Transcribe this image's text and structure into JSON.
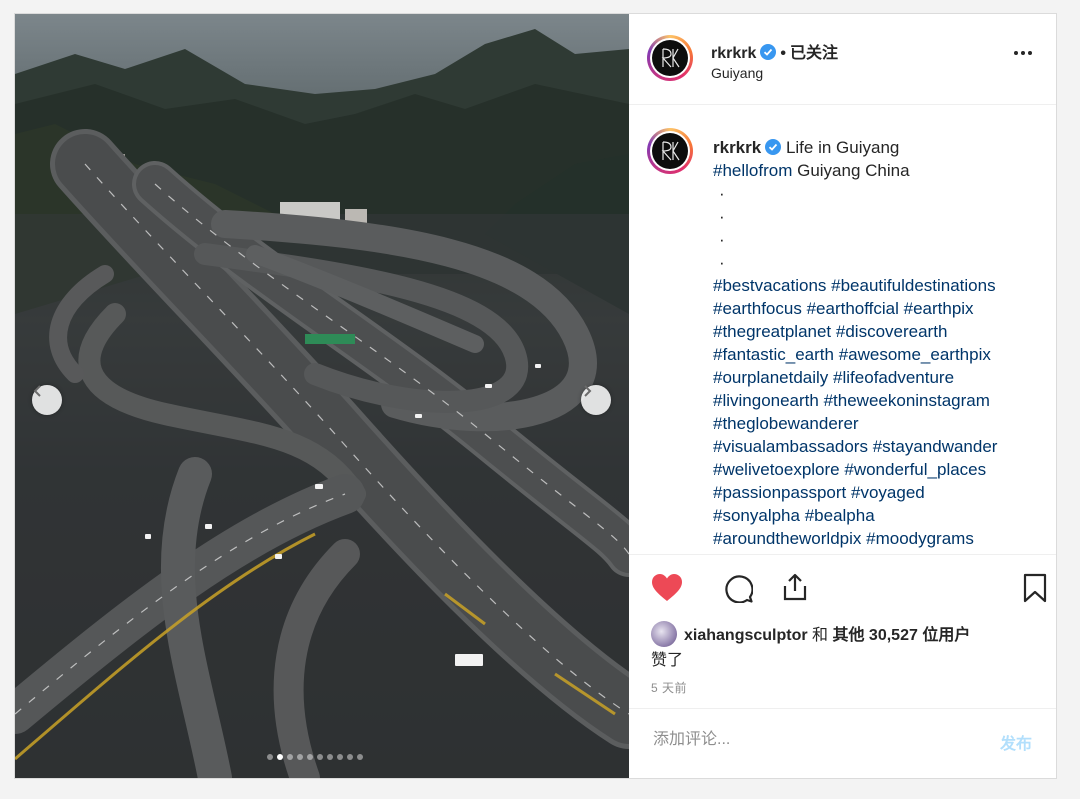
{
  "header": {
    "username": "rkrkrk",
    "separator": "•",
    "follow_status": "已关注",
    "location": "Guiyang",
    "more_icon": "more-horizontal-icon",
    "avatar_monogram": "RK"
  },
  "media": {
    "prev_icon": "chevron-left-icon",
    "next_icon": "chevron-right-icon",
    "carousel": {
      "count": 10,
      "active_index": 1
    }
  },
  "caption": {
    "username": "rkrkrk",
    "first_line_text": "Life in Guiyang",
    "second_line": {
      "hashtag": "#hellofrom",
      "text": " Guiyang China"
    },
    "dots": [
      "·",
      "·",
      "·",
      "·"
    ],
    "hashtag_lines": [
      [
        "#bestvacations",
        "#beautifuldestinations"
      ],
      [
        "#earthfocus",
        "#earthoffcial",
        "#earthpix"
      ],
      [
        "#thegreatplanet",
        "#discoverearth"
      ],
      [
        "#fantastic_earth",
        "#awesome_earthpix"
      ],
      [
        "#ourplanetdaily",
        "#lifeofadventure"
      ],
      [
        "#livingonearth",
        "#theweekoninstagram"
      ],
      [
        "#theglobewanderer"
      ],
      [
        "#visualambassadors",
        "#stayandwander"
      ],
      [
        "#welivetoexplore",
        "#wonderful_places"
      ],
      [
        "#passionpassport",
        "#voyaged"
      ],
      [
        "#sonyalpha",
        "#bealpha"
      ],
      [
        "#aroundtheworldpix",
        "#moodygrams"
      ]
    ]
  },
  "actions": {
    "like_icon": "heart-filled-icon",
    "comment_icon": "comment-bubble-icon",
    "share_icon": "share-upload-icon",
    "save_icon": "bookmark-icon",
    "liked_by": "xiahangsculptor",
    "and_text": " 和 ",
    "others_text": "其他 30,527 位用户",
    "liked_suffix": "赞了",
    "timestamp": "5 天前"
  },
  "comment": {
    "placeholder": "添加评论...",
    "post_label": "发布"
  },
  "colors": {
    "like_red": "#ed4956",
    "verified_blue": "#3897f0",
    "hashtag": "#003569",
    "post_button_disabled": "#b2dffc",
    "muted_text": "#8e8e8e"
  }
}
